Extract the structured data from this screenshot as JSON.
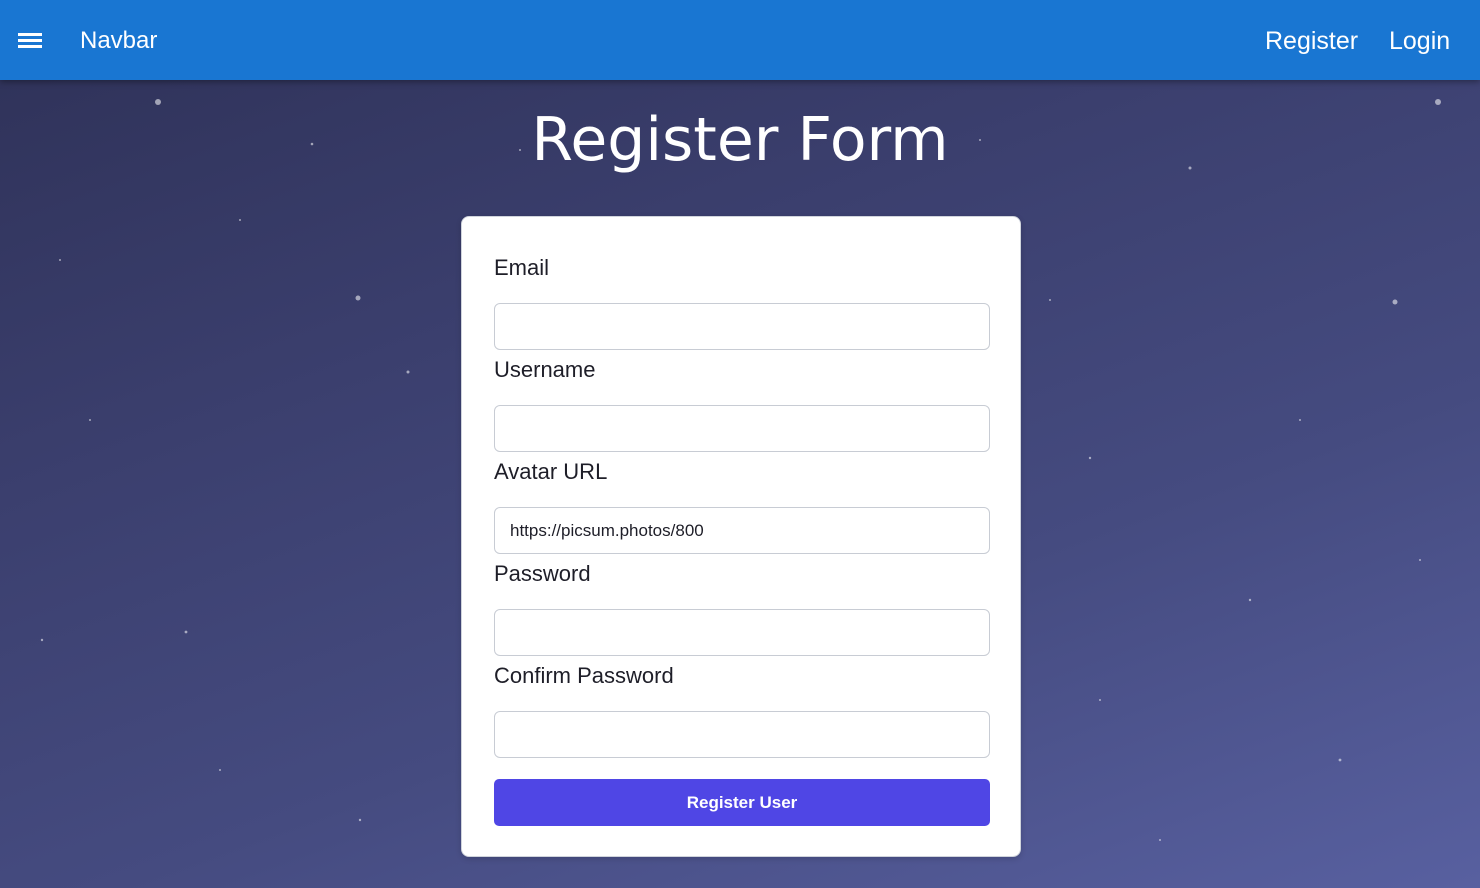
{
  "navbar": {
    "title": "Navbar",
    "menu_icon": "hamburger-menu-icon",
    "links": {
      "register": "Register",
      "login": "Login"
    },
    "background": "#1976d2"
  },
  "page": {
    "title": "Register Form"
  },
  "form": {
    "email": {
      "label": "Email",
      "value": ""
    },
    "username": {
      "label": "Username",
      "value": ""
    },
    "avatar_url": {
      "label": "Avatar URL",
      "value": "https://picsum.photos/800"
    },
    "password": {
      "label": "Password",
      "value": ""
    },
    "confirm_password": {
      "label": "Confirm Password",
      "value": ""
    },
    "submit_label": "Register User",
    "submit_color": "#4f46e5"
  }
}
